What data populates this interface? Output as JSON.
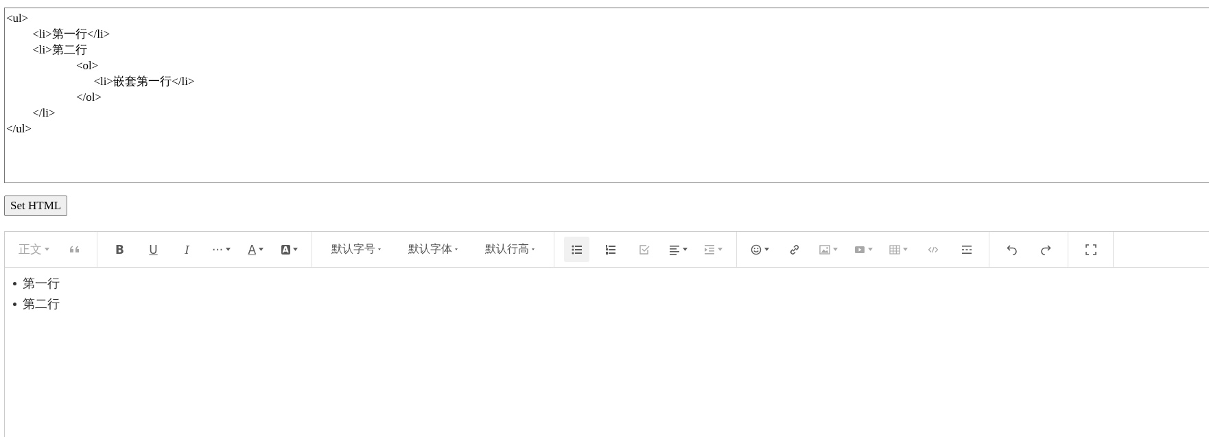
{
  "html_source": {
    "value": "<ul>\n         <li>第一行</li>\n         <li>第二行\n                        <ol>\n                              <li>嵌套第一行</li>\n                        </ol>\n         </li>\n</ul>"
  },
  "set_button": {
    "label": "Set HTML"
  },
  "toolbar": {
    "groups": [
      {
        "tools": [
          {
            "kind": "heading",
            "label": "正文",
            "dropdown": true,
            "disabled": true,
            "active": false
          },
          {
            "kind": "quote",
            "dropdown": false,
            "disabled": true,
            "active": false
          }
        ]
      },
      {
        "tools": [
          {
            "kind": "bold",
            "label": "B",
            "dropdown": false,
            "disabled": false,
            "active": false
          },
          {
            "kind": "underline",
            "label": "U",
            "dropdown": false,
            "disabled": false,
            "active": false
          },
          {
            "kind": "italic",
            "label": "I",
            "dropdown": false,
            "disabled": false,
            "active": false
          },
          {
            "kind": "more",
            "label": "···",
            "dropdown": true,
            "disabled": false,
            "active": false
          },
          {
            "kind": "color",
            "label": "A",
            "dropdown": true,
            "disabled": false,
            "active": false
          },
          {
            "kind": "bgcolor",
            "label": "A",
            "dropdown": true,
            "disabled": false,
            "active": false
          }
        ]
      },
      {
        "tools": [
          {
            "kind": "menu",
            "label": "默认字号",
            "dropdown": true,
            "disabled": false,
            "active": false
          },
          {
            "kind": "menu",
            "label": "默认字体",
            "dropdown": true,
            "disabled": false,
            "active": false
          },
          {
            "kind": "menu",
            "label": "默认行高",
            "dropdown": true,
            "disabled": false,
            "active": false
          }
        ]
      },
      {
        "tools": [
          {
            "kind": "bulleted-list",
            "dropdown": false,
            "disabled": false,
            "active": true
          },
          {
            "kind": "numbered-list",
            "dropdown": false,
            "disabled": false,
            "active": false
          },
          {
            "kind": "todo",
            "dropdown": false,
            "disabled": true,
            "active": false
          },
          {
            "kind": "align",
            "dropdown": true,
            "disabled": false,
            "active": false
          },
          {
            "kind": "indent",
            "dropdown": true,
            "disabled": true,
            "active": false
          }
        ]
      },
      {
        "tools": [
          {
            "kind": "emoji",
            "dropdown": true,
            "disabled": false,
            "active": false
          },
          {
            "kind": "link",
            "dropdown": false,
            "disabled": false,
            "active": false
          },
          {
            "kind": "image",
            "dropdown": true,
            "disabled": true,
            "active": false
          },
          {
            "kind": "video",
            "dropdown": true,
            "disabled": true,
            "active": false
          },
          {
            "kind": "table",
            "dropdown": true,
            "disabled": true,
            "active": false
          },
          {
            "kind": "code",
            "dropdown": false,
            "disabled": true,
            "active": false
          },
          {
            "kind": "divider",
            "dropdown": false,
            "disabled": false,
            "active": false
          }
        ]
      },
      {
        "tools": [
          {
            "kind": "undo",
            "dropdown": false,
            "disabled": false,
            "active": false
          },
          {
            "kind": "redo",
            "dropdown": false,
            "disabled": false,
            "active": false
          }
        ]
      },
      {
        "tools": [
          {
            "kind": "fullscreen",
            "dropdown": false,
            "disabled": false,
            "active": false
          }
        ]
      }
    ]
  },
  "content": {
    "items": [
      {
        "text": "第一行"
      },
      {
        "text": "第二行"
      }
    ]
  }
}
